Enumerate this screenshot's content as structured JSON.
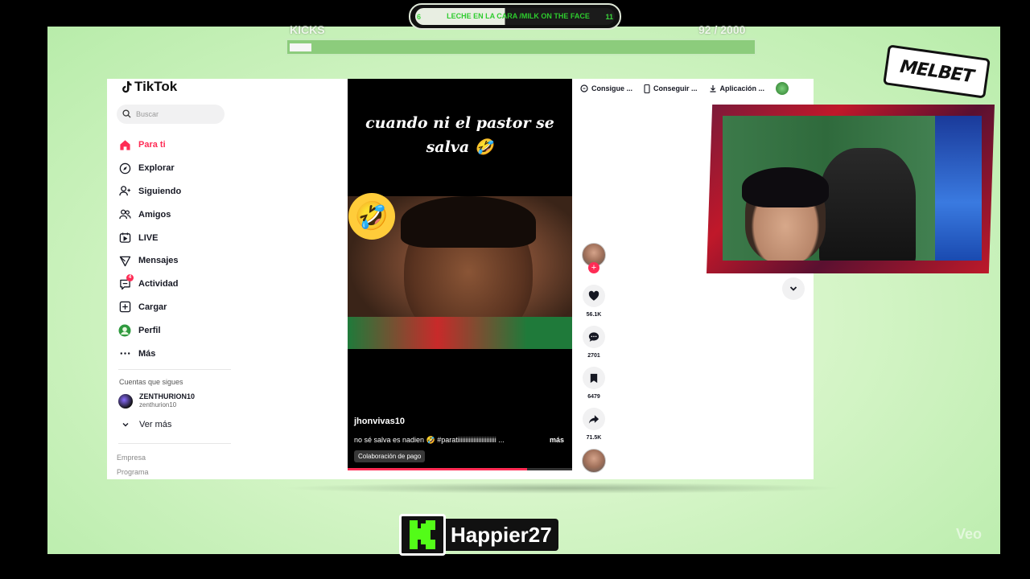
{
  "overlay": {
    "goal_left_num": "6",
    "goal_right_num": "11",
    "goal_text": "LECHE EN LA CARA /MILK ON THE FACE",
    "goal_progress": 0.45,
    "kicks_label": "KICKS",
    "kicks_count": "92  / 2000",
    "kicks_progress": 0.046,
    "sponsor": "MELBET",
    "streamer_name": "Happier27",
    "watermark": "Veo"
  },
  "tiktok": {
    "logo": "TikTok",
    "search_placeholder": "Buscar",
    "nav": [
      {
        "label": "Para ti",
        "icon": "home-icon",
        "active": true
      },
      {
        "label": "Explorar",
        "icon": "compass-icon"
      },
      {
        "label": "Siguiendo",
        "icon": "following-icon"
      },
      {
        "label": "Amigos",
        "icon": "friends-icon"
      },
      {
        "label": "LIVE",
        "icon": "live-icon"
      },
      {
        "label": "Mensajes",
        "icon": "messages-icon"
      },
      {
        "label": "Actividad",
        "icon": "activity-icon",
        "badge": "4"
      },
      {
        "label": "Cargar",
        "icon": "upload-icon"
      },
      {
        "label": "Perfil",
        "icon": "profile-icon"
      },
      {
        "label": "Más",
        "icon": "more-icon"
      }
    ],
    "following_title": "Cuentas que sigues",
    "following_user": {
      "name": "ZENTHURION10",
      "handle": "zenthurion10"
    },
    "see_more": "Ver más",
    "footer": [
      "Empresa",
      "Programa"
    ],
    "topbar": [
      "Consigue ...",
      "Conseguir ...",
      "Aplicación ..."
    ],
    "video": {
      "caption": "cuando ni el pastor se salva 🤣",
      "username": "jhonvivas10",
      "description": "no sé salva es nadien 🤣 #paratiiiiiiiiiiiiiiiiiiiiiiii ...",
      "more": "más",
      "paid_tag": "Colaboración de pago",
      "progress": 0.8
    },
    "actions": {
      "likes": "56.1K",
      "comments": "2701",
      "saves": "6479",
      "shares": "71.5K"
    }
  }
}
